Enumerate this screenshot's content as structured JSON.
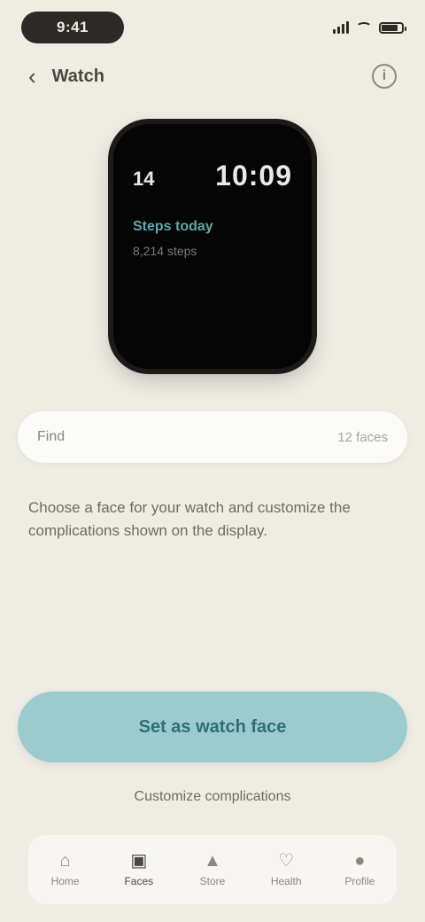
{
  "status_bar": {
    "time": "9:41",
    "battery_level": 0.8
  },
  "header": {
    "back_label": "Watch",
    "info_label": "i"
  },
  "watch_preview": {
    "date": "14",
    "time": "10:09",
    "line1": "Steps today",
    "line2": "8,214 steps"
  },
  "search": {
    "label": "Find",
    "placeholder": "",
    "count": "12 faces"
  },
  "description": "Choose a face for your watch and customize the complications shown on the display.",
  "primary_button": {
    "label": "Set as watch face"
  },
  "secondary_link": {
    "label": "Customize complications"
  },
  "bottom_nav": {
    "items": [
      {
        "label": "Home",
        "icon": "home-icon"
      },
      {
        "label": "Faces",
        "icon": "watch-icon"
      },
      {
        "label": "Store",
        "icon": "store-icon"
      },
      {
        "label": "Health",
        "icon": "heart-icon"
      },
      {
        "label": "Profile",
        "icon": "user-icon"
      }
    ]
  },
  "colors": {
    "background": "#efece4",
    "accent": "#9bcbcf",
    "accent_text": "#2f6e73",
    "watch_screen": "#050505"
  }
}
